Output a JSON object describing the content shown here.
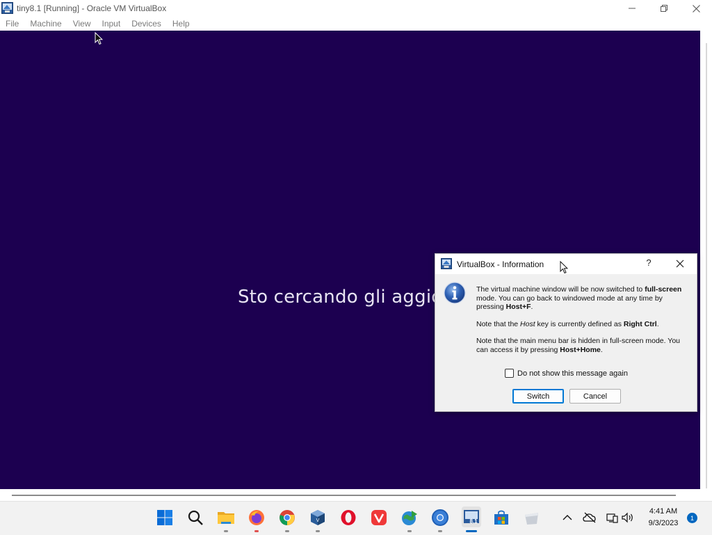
{
  "window": {
    "title": "tiny8.1 [Running] - Oracle VM VirtualBox",
    "icons": [
      "virtualbox-icon",
      "minimize-icon",
      "maximize-icon",
      "close-icon"
    ]
  },
  "menubar": {
    "items": [
      "File",
      "Machine",
      "View",
      "Input",
      "Devices",
      "Help"
    ]
  },
  "vm": {
    "background_color": "#1c0050",
    "status_text": "Sto cercando gli aggiorna"
  },
  "dialog": {
    "title": "VirtualBox - Information",
    "help_label": "?",
    "icon": "info-icon",
    "paragraph1": {
      "t1": "The virtual machine window will be now switched to ",
      "b1": "full-screen",
      "t2": " mode. You can go back to windowed mode at any time by pressing ",
      "b2": "Host+F",
      "t3": "."
    },
    "paragraph2": {
      "t1": "Note that the ",
      "i1": "Host",
      "t2": " key is currently defined as ",
      "b1": "Right Ctrl",
      "t3": "."
    },
    "paragraph3": {
      "t1": "Note that the main menu bar is hidden in full-screen mode. You can access it by pressing ",
      "b1": "Host+Home",
      "t2": "."
    },
    "checkbox_label": "Do not show this message again",
    "checkbox_checked": false,
    "switch_label": "Switch",
    "cancel_label": "Cancel"
  },
  "taskbar": {
    "apps": [
      "start-icon",
      "search-icon",
      "file-explorer-icon",
      "firefox-icon",
      "chrome-icon",
      "virtualbox-app-icon",
      "opera-icon",
      "vivaldi-icon",
      "network-globe-icon",
      "chromium-icon",
      "tiny8-vm-icon",
      "store-icon",
      "bucket-app-icon"
    ],
    "tray": [
      "chevron-up-icon",
      "cloud-offline-icon",
      "network-icon",
      "volume-icon"
    ],
    "time": "4:41 AM",
    "date": "9/3/2023",
    "notification_count": "1",
    "accent": "#0067c0"
  }
}
